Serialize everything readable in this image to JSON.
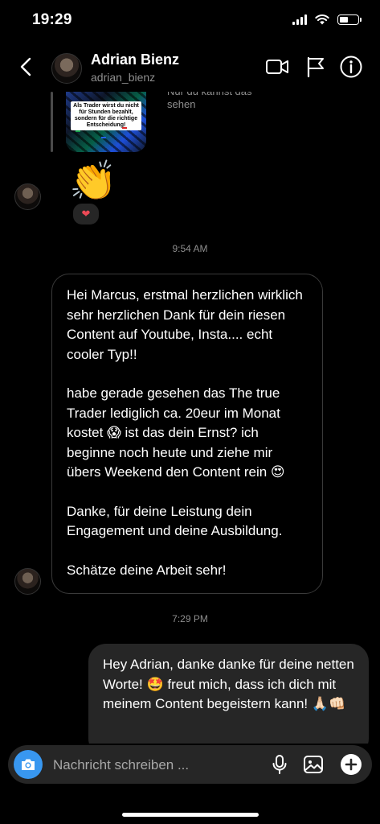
{
  "status": {
    "time": "19:29",
    "battery_level": 0.5
  },
  "header": {
    "name": "Adrian Bienz",
    "username": "adrian_bienz"
  },
  "story": {
    "caption": "Als Trader wirst du nicht für Stunden bezahlt, sondern für die richtige Entscheidung!",
    "note": "Nur du kannst das sehen"
  },
  "messages": {
    "sticker": "👏",
    "reaction": "❤",
    "timestamp_1": "9:54 AM",
    "incoming_paragraphs": [
      "Hei Marcus, erstmal herzlichen wirklich sehr herzlichen Dank für dein riesen Content auf Youtube, Insta.... echt cooler Typ!!",
      "habe gerade gesehen das The true Trader lediglich ca. 20eur im Monat kostet 😱 ist das dein Ernst? ich beginne noch heute und ziehe mir übers Weekend den Content rein 😍",
      "Danke, für deine Leistung dein Engagement und deine Ausbildung.",
      "Schätze deine Arbeit sehr!"
    ],
    "timestamp_2": "7:29 PM",
    "outgoing": "Hey Adrian, danke danke für deine netten Worte! 🤩 freut mich, dass ich dich mit meinem Content begeistern kann! 🙏🏻👊🏻"
  },
  "composer": {
    "placeholder": "Nachricht schreiben ..."
  },
  "colors": {
    "accent": "#3897f0",
    "bubble_out": "#262626",
    "reaction": "#ed4956"
  }
}
